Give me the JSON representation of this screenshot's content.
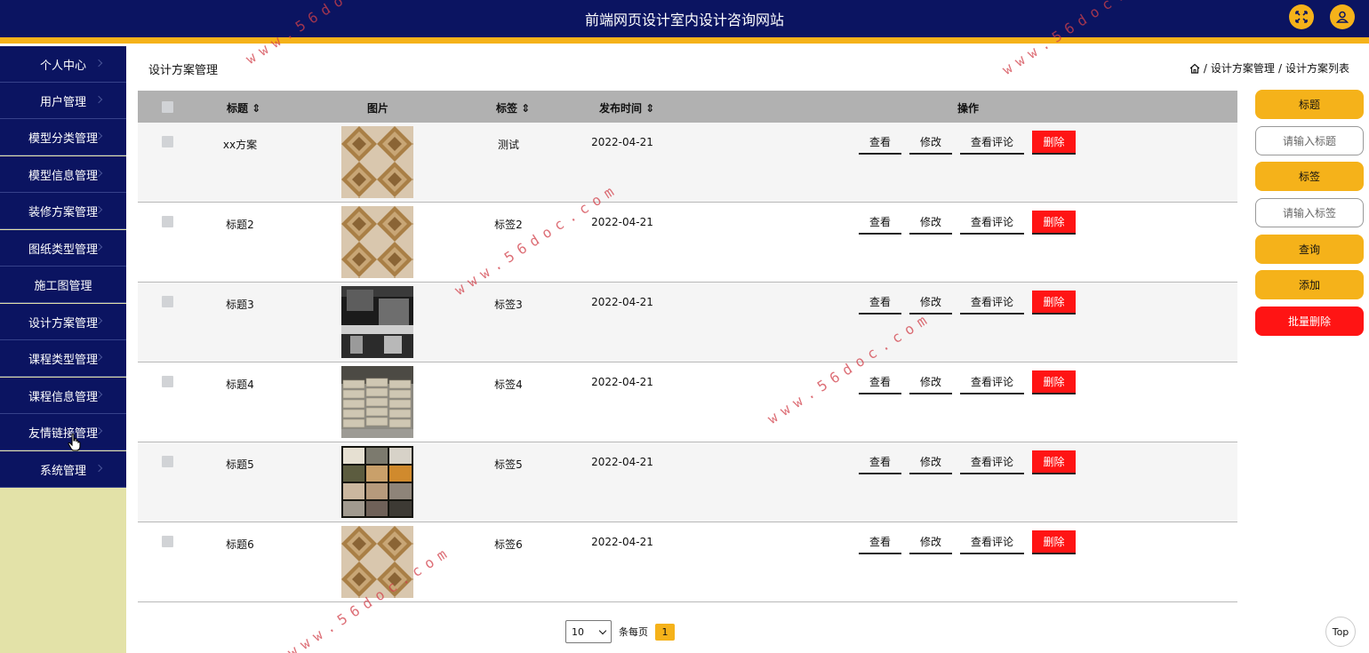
{
  "header": {
    "title": "前端网页设计室内设计咨询网站"
  },
  "sidebar": {
    "items": [
      {
        "label": "个人中心"
      },
      {
        "label": "用户管理"
      },
      {
        "label": "模型分类管理"
      },
      {
        "label": "模型信息管理"
      },
      {
        "label": "装修方案管理"
      },
      {
        "label": "图纸类型管理"
      },
      {
        "label": "施工图管理"
      },
      {
        "label": "设计方案管理"
      },
      {
        "label": "课程类型管理"
      },
      {
        "label": "课程信息管理"
      },
      {
        "label": "友情链接管理"
      },
      {
        "label": "系统管理"
      }
    ]
  },
  "main": {
    "page_title": "设计方案管理",
    "breadcrumb": {
      "sep": "/",
      "level1": "设计方案管理",
      "level2": "设计方案列表"
    }
  },
  "table": {
    "columns": {
      "title": "标题",
      "image": "图片",
      "tag": "标签",
      "date": "发布时间",
      "ops": "操作"
    },
    "actions": {
      "view": "查看",
      "edit": "修改",
      "comments": "查看评论",
      "delete": "删除"
    },
    "rows": [
      {
        "title": "xx方案",
        "tag": "测试",
        "date": "2022-04-21",
        "image": "diamond-tile"
      },
      {
        "title": "标题2",
        "tag": "标签2",
        "date": "2022-04-21",
        "image": "diamond-tile"
      },
      {
        "title": "标题3",
        "tag": "标签3",
        "date": "2022-04-21",
        "image": "kitchen"
      },
      {
        "title": "标题4",
        "tag": "标签4",
        "date": "2022-04-21",
        "image": "cement-bags"
      },
      {
        "title": "标题5",
        "tag": "标签5",
        "date": "2022-04-21",
        "image": "stone-samples"
      },
      {
        "title": "标题6",
        "tag": "标签6",
        "date": "2022-04-21",
        "image": "diamond-tile"
      }
    ]
  },
  "pagination": {
    "page_size": "10",
    "per_page_label": "条每页",
    "current_page": "1"
  },
  "search_panel": {
    "title_label": "标题",
    "title_placeholder": "请输入标题",
    "tag_label": "标签",
    "tag_placeholder": "请输入标签",
    "query": "查询",
    "add": "添加",
    "batch_delete": "批量删除"
  },
  "top_button": "Top",
  "watermark": "www.56doc.com",
  "colors": {
    "nav": "#0b1461",
    "accent": "#f5b21a",
    "danger": "#ff1414",
    "sidebar_bg": "#e3e2a8"
  }
}
